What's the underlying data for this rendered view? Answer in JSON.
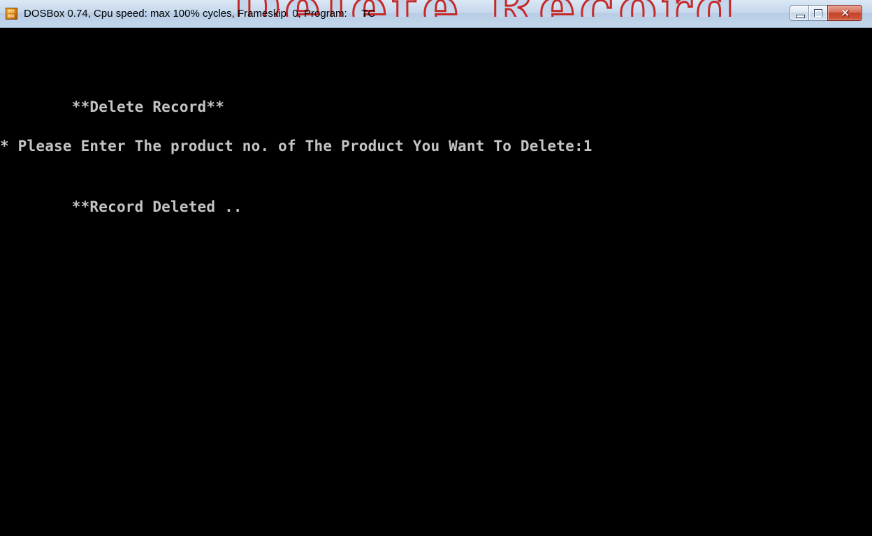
{
  "window": {
    "title": "DOSBox 0.74, Cpu speed: max 100% cycles, Frameskip  0, Program:     TC",
    "app_icon": "dosbox-icon",
    "app_icon_text": [
      "DOS",
      "BOX"
    ],
    "background_overlay_text": "Delete Record",
    "buttons": {
      "minimize": "minimize-icon",
      "maximize": "maximize-icon",
      "close": "close-icon",
      "close_glyph": "✕"
    }
  },
  "console": {
    "lines": [
      "        **Delete Record**",
      "* Please Enter The product no. of The Product You Want To Delete:1",
      "        **Record Deleted .."
    ],
    "text_color": "#c4c4c4",
    "background_color": "#000000"
  }
}
